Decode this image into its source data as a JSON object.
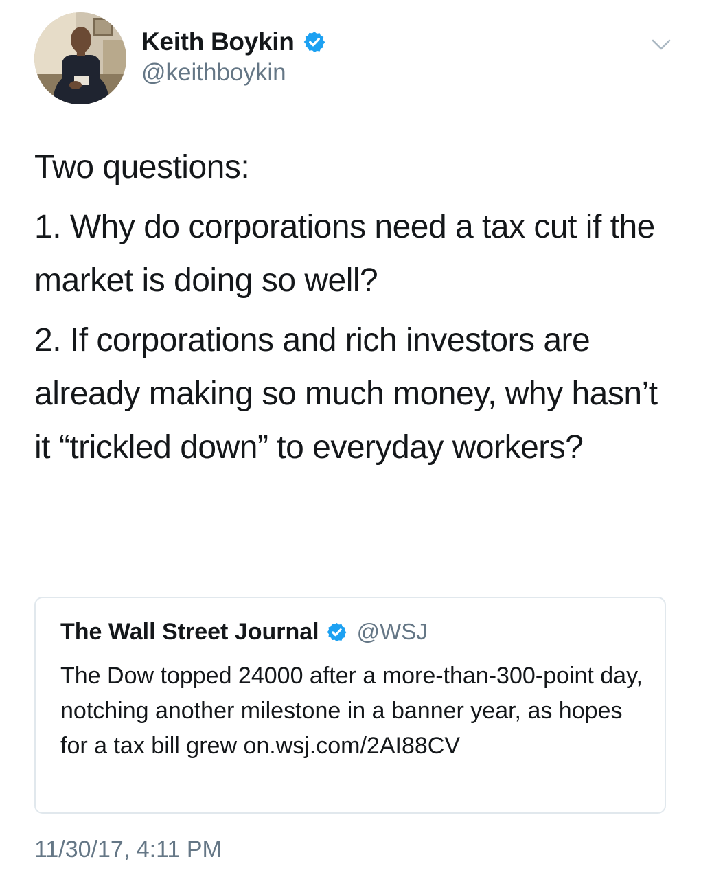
{
  "author": {
    "display_name": "Keith Boykin",
    "handle": "@keithboykin",
    "verified": true,
    "avatar_icon": "profile-photo"
  },
  "menu_icon": "chevron-down-icon",
  "tweet": {
    "paragraphs": [
      "Two questions:",
      "1. Why do corporations need a tax cut if the market is doing so well?",
      "2. If corporations and rich investors are already making so much money, why hasn’t it “trickled down” to everyday workers?"
    ],
    "timestamp": "11/30/17, 4:11 PM"
  },
  "quoted_tweet": {
    "display_name": "The Wall Street Journal",
    "handle": "@WSJ",
    "verified": true,
    "text": "The Dow topped 24000 after a more-than-300-point day, notching another milestone in a banner year, as hopes for a tax bill grew on.wsj.com/2AI88CV"
  },
  "colors": {
    "text_primary": "#14171a",
    "text_secondary": "#657786",
    "verified_blue": "#1da1f2",
    "border": "#e1e8ed"
  }
}
